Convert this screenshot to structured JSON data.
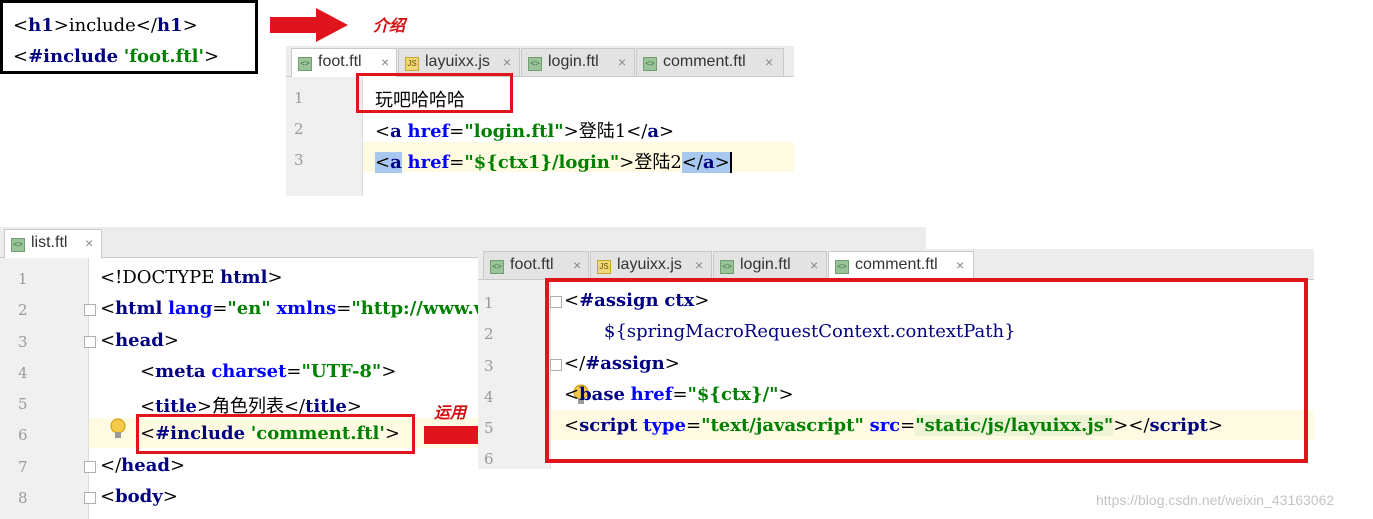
{
  "snippet": {
    "line1": {
      "open_lt": "<",
      "open_tag": "h1",
      "open_gt": ">",
      "text": "include",
      "close_lt": "</",
      "close_tag": "h1",
      "close_gt": ">"
    },
    "line2": {
      "lt": "<",
      "directive": "#include",
      "sp": " ",
      "value": "'foot.ftl'",
      "gt": ">"
    }
  },
  "annotations": {
    "intro": "介绍",
    "usage": "运用"
  },
  "foot_panel": {
    "tabs": [
      {
        "label": "foot.ftl",
        "icon": "ftl-file-icon",
        "icon_text": "<>",
        "close": "×"
      },
      {
        "label": "layuixx.js",
        "icon": "js-file-icon",
        "icon_text": "JS",
        "close": "×"
      },
      {
        "label": "login.ftl",
        "icon": "ftl-file-icon",
        "icon_text": "<>",
        "close": "×"
      },
      {
        "label": "comment.ftl",
        "icon": "ftl-file-icon",
        "icon_text": "<>",
        "close": "×"
      }
    ],
    "line_numbers": [
      "1",
      "2",
      "3"
    ],
    "lines": {
      "l1": "玩吧哈哈哈",
      "l2": {
        "lt": "<",
        "tag": "a",
        "sp": " ",
        "attr": "href",
        "eq": "=",
        "val": "\"login.ftl\"",
        "gt": ">",
        "text": "登陆1",
        "close_lt": "</",
        "close_tag": "a",
        "close_gt": ">"
      },
      "l3": {
        "lt": "<",
        "tag": "a",
        "sp": " ",
        "attr": "href",
        "eq": "=",
        "val": "\"${ctx1}/login\"",
        "gt": ">",
        "text": "登陆2",
        "close_lt": "</",
        "close_tag": "a",
        "close_gt": ">"
      }
    }
  },
  "list_panel": {
    "tab": {
      "label": "list.ftl",
      "icon": "ftl-file-icon",
      "icon_text": "<>",
      "close": "×"
    },
    "line_numbers": [
      "1",
      "2",
      "3",
      "4",
      "5",
      "6",
      "7",
      "8"
    ],
    "lines": {
      "l1": {
        "pre": "<!DOCTYPE ",
        "kw": "html",
        "post": ">"
      },
      "l2": {
        "lt": "<",
        "tag": "html",
        "sp": " ",
        "a1": "lang",
        "eq1": "=",
        "v1": "\"en\"",
        "sp2": " ",
        "a2": "xmlns",
        "eq2": "=",
        "v2": "\"http://www.w"
      },
      "l3": {
        "lt": "<",
        "tag": "head",
        "gt": ">"
      },
      "l4": {
        "lt": "<",
        "tag": "meta",
        "sp": " ",
        "attr": "charset",
        "eq": "=",
        "val": "\"UTF-8\"",
        "gt": ">"
      },
      "l5": {
        "lt": "<",
        "tag": "title",
        "gt": ">",
        "text": "角色列表",
        "close_lt": "</",
        "close_tag": "title",
        "close_gt": ">"
      },
      "l6": {
        "lt": "<",
        "directive": "#include",
        "sp": " ",
        "value": "'comment.ftl'",
        "gt": ">"
      },
      "l7": {
        "lt": "</",
        "tag": "head",
        "gt": ">"
      },
      "l8": {
        "lt": "<",
        "tag": "body",
        "gt": ">"
      }
    }
  },
  "comment_panel": {
    "tabs": [
      {
        "label": "foot.ftl",
        "icon": "ftl-file-icon",
        "icon_text": "<>",
        "close": "×"
      },
      {
        "label": "layuixx.js",
        "icon": "js-file-icon",
        "icon_text": "JS",
        "close": "×"
      },
      {
        "label": "login.ftl",
        "icon": "ftl-file-icon",
        "icon_text": "<>",
        "close": "×"
      },
      {
        "label": "comment.ftl",
        "icon": "ftl-file-icon",
        "icon_text": "<>",
        "close": "×"
      }
    ],
    "line_numbers": [
      "1",
      "2",
      "3",
      "4",
      "5",
      "6"
    ],
    "lines": {
      "l1": {
        "lt": "<",
        "directive": "#assign",
        "sp": " ",
        "var": "ctx",
        "gt": ">"
      },
      "l2": {
        "expr": "${springMacroRequestContext.contextPath}"
      },
      "l3": {
        "lt": "</",
        "directive": "#assign",
        "gt": ">"
      },
      "l4": {
        "lt": "<",
        "tag": "base",
        "sp": " ",
        "attr": "href",
        "eq": "=",
        "val": "\"${ctx}/\"",
        "gt": ">"
      },
      "l5": {
        "lt": "<",
        "tag": "script",
        "sp": " ",
        "a1": "type",
        "eq1": "=",
        "v1": "\"text/javascript\"",
        "sp2": " ",
        "a2": "src",
        "eq2": "=",
        "v2": "\"static/js/layuixx.js\"",
        "gt": ">",
        "close_lt": "</",
        "close_tag": "script",
        "close_gt": ">"
      }
    }
  },
  "watermark": "https://blog.csdn.net/weixin_43163062",
  "colors": {
    "annotation_red": "#e0141c",
    "tag_navy": "#000080",
    "string_green": "#008000",
    "attr_blue": "#0000ff"
  }
}
